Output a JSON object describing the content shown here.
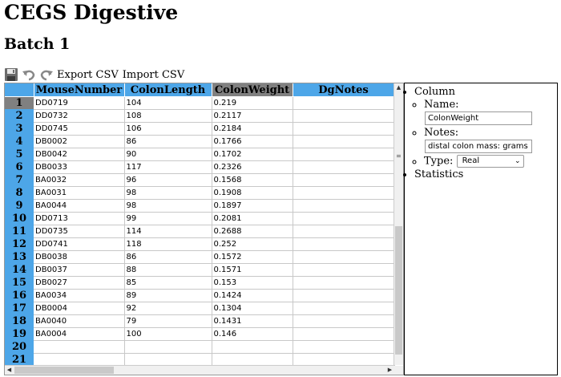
{
  "page": {
    "title": "CEGS Digestive",
    "subtitle": "Batch 1"
  },
  "toolbar": {
    "save_icon": "save-icon",
    "undo_icon": "undo-icon",
    "redo_icon": "redo-icon",
    "export_label": "Export CSV",
    "import_label": "Import CSV"
  },
  "grid": {
    "columns": [
      "MouseNumber",
      "ColonLength",
      "ColonWeight",
      "DgNotes"
    ],
    "selected_column": "ColonWeight",
    "selected_row": "1",
    "rows": [
      {
        "num": "1",
        "mouse": "DD0719",
        "length": "104",
        "weight": "0.219",
        "notes": ""
      },
      {
        "num": "2",
        "mouse": "DD0732",
        "length": "108",
        "weight": "0.2117",
        "notes": ""
      },
      {
        "num": "3",
        "mouse": "DD0745",
        "length": "106",
        "weight": "0.2184",
        "notes": ""
      },
      {
        "num": "4",
        "mouse": "DB0002",
        "length": "86",
        "weight": "0.1766",
        "notes": ""
      },
      {
        "num": "5",
        "mouse": "DB0042",
        "length": "90",
        "weight": "0.1702",
        "notes": ""
      },
      {
        "num": "6",
        "mouse": "DB0033",
        "length": "117",
        "weight": "0.2326",
        "notes": ""
      },
      {
        "num": "7",
        "mouse": "BA0032",
        "length": "96",
        "weight": "0.1568",
        "notes": ""
      },
      {
        "num": "8",
        "mouse": "BA0031",
        "length": "98",
        "weight": "0.1908",
        "notes": ""
      },
      {
        "num": "9",
        "mouse": "BA0044",
        "length": "98",
        "weight": "0.1897",
        "notes": ""
      },
      {
        "num": "10",
        "mouse": "DD0713",
        "length": "99",
        "weight": "0.2081",
        "notes": ""
      },
      {
        "num": "11",
        "mouse": "DD0735",
        "length": "114",
        "weight": "0.2688",
        "notes": ""
      },
      {
        "num": "12",
        "mouse": "DD0741",
        "length": "118",
        "weight": "0.252",
        "notes": ""
      },
      {
        "num": "13",
        "mouse": "DB0038",
        "length": "86",
        "weight": "0.1572",
        "notes": ""
      },
      {
        "num": "14",
        "mouse": "DB0037",
        "length": "88",
        "weight": "0.1571",
        "notes": ""
      },
      {
        "num": "15",
        "mouse": "DB0027",
        "length": "85",
        "weight": "0.153",
        "notes": ""
      },
      {
        "num": "16",
        "mouse": "BA0034",
        "length": "89",
        "weight": "0.1424",
        "notes": ""
      },
      {
        "num": "17",
        "mouse": "DB0004",
        "length": "92",
        "weight": "0.1304",
        "notes": ""
      },
      {
        "num": "18",
        "mouse": "BA0040",
        "length": "79",
        "weight": "0.1431",
        "notes": ""
      },
      {
        "num": "19",
        "mouse": "BA0004",
        "length": "100",
        "weight": "0.146",
        "notes": ""
      },
      {
        "num": "20",
        "mouse": "",
        "length": "",
        "weight": "",
        "notes": ""
      },
      {
        "num": "21",
        "mouse": "",
        "length": "",
        "weight": "",
        "notes": ""
      }
    ]
  },
  "panel": {
    "column_heading": "Column",
    "name_label": "Name:",
    "name_value": "ColonWeight",
    "notes_label": "Notes:",
    "notes_value": "distal colon mass: grams",
    "type_label": "Type:",
    "type_value": "Real",
    "statistics_heading": "Statistics"
  },
  "colors": {
    "header_blue": "#4da6e8",
    "selected_gray": "#808080"
  }
}
